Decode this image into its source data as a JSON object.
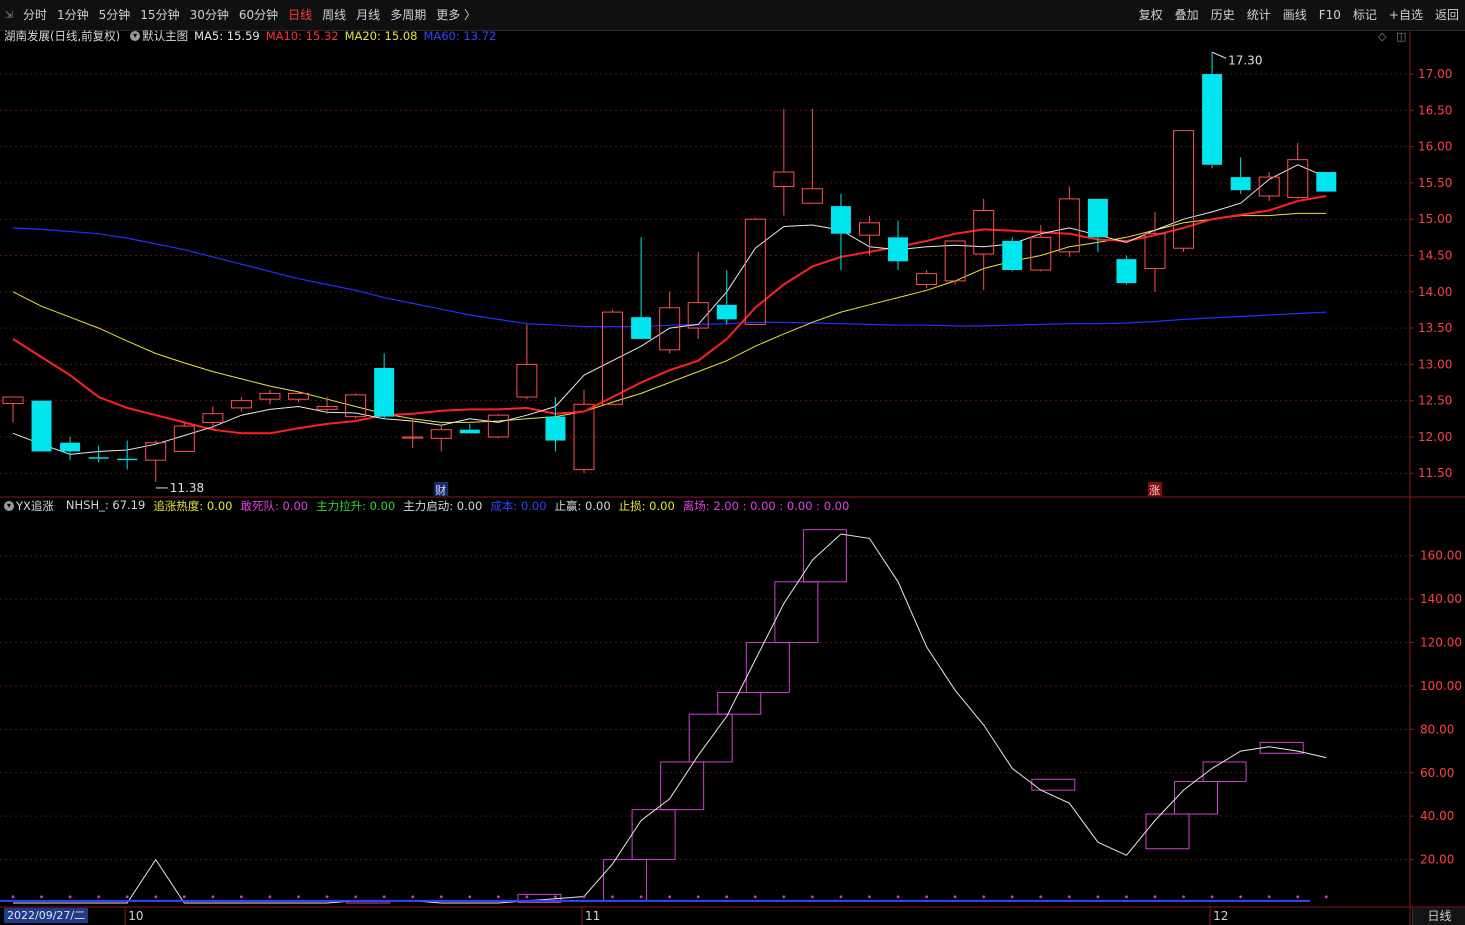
{
  "periods": [
    {
      "label": "分时"
    },
    {
      "label": "1分钟"
    },
    {
      "label": "5分钟"
    },
    {
      "label": "15分钟"
    },
    {
      "label": "30分钟"
    },
    {
      "label": "60分钟"
    },
    {
      "label": "日线",
      "active": true
    },
    {
      "label": "周线"
    },
    {
      "label": "月线"
    },
    {
      "label": "多周期"
    },
    {
      "label": "更多 〉"
    }
  ],
  "tools": [
    "复权",
    "叠加",
    "历史",
    "统计",
    "画线",
    "F10",
    "标记",
    "+自选",
    "返回"
  ],
  "header": {
    "stock_title": "湖南发展(日线,前复权)",
    "main_chart_name": "默认主图",
    "ma5_label": "MA5: 15.59",
    "ma10_label": "MA10: 15.32",
    "ma20_label": "MA20: 15.08",
    "ma60_label": "MA60: 13.72"
  },
  "indicator_header": {
    "name": "YX追涨",
    "items": [
      {
        "text": "NHSH_: 67.19",
        "color": "#d8d8d8"
      },
      {
        "text": "追涨热度: 0.00",
        "color": "#e5e53a"
      },
      {
        "text": "敢死队: 0.00",
        "color": "#e040e0"
      },
      {
        "text": "主力拉升: 0.00",
        "color": "#30d030"
      },
      {
        "text": "主力启动: 0.00",
        "color": "#d8d8d8"
      },
      {
        "text": "成本: 0.00",
        "color": "#3344ff"
      },
      {
        "text": "止赢: 0.00",
        "color": "#d8d8d8"
      },
      {
        "text": "止损: 0.00",
        "color": "#e5e53a"
      },
      {
        "text": "离场: 2.00 : 0.00 : 0.00 : 0.00",
        "color": "#e040e0"
      }
    ]
  },
  "colors": {
    "up": "#ff5050",
    "down": "#00e5ee",
    "ma5": "#e8e8e8",
    "ma10": "#ff2020",
    "ma20": "#e5e53a",
    "ma60": "#2030ff",
    "grid": "#5a1010",
    "nhsh": "#e8e8e8",
    "box": "#d040d0",
    "bottom_line": "#3344ff"
  },
  "annotations": {
    "high_label": "17.30",
    "low_label": "11.38",
    "cai_mark": "财",
    "zhang_mark": "涨"
  },
  "date_label": "2022/09/27/二",
  "x_month_labels": [
    "10",
    "11",
    "12"
  ],
  "right_button": "日线",
  "chart_data": [
    {
      "type": "candlestick",
      "title": "湖南发展(日线,前复权)",
      "ylim": [
        11.2,
        17.4
      ],
      "y_ticks": [
        11.5,
        12.0,
        12.5,
        13.0,
        13.5,
        14.0,
        14.5,
        15.0,
        15.5,
        16.0,
        16.5,
        17.0
      ],
      "candles": [
        {
          "o": 12.46,
          "h": 12.55,
          "l": 12.2,
          "c": 12.55
        },
        {
          "o": 12.5,
          "h": 12.5,
          "l": 11.8,
          "c": 11.8
        },
        {
          "o": 11.92,
          "h": 12.0,
          "l": 11.68,
          "c": 11.8
        },
        {
          "o": 11.72,
          "h": 11.88,
          "l": 11.65,
          "c": 11.7
        },
        {
          "o": 11.7,
          "h": 11.95,
          "l": 11.55,
          "c": 11.68
        },
        {
          "o": 11.68,
          "h": 11.95,
          "l": 11.38,
          "c": 11.92
        },
        {
          "o": 11.8,
          "h": 12.2,
          "l": 11.8,
          "c": 12.15
        },
        {
          "o": 12.2,
          "h": 12.42,
          "l": 12.1,
          "c": 12.32
        },
        {
          "o": 12.4,
          "h": 12.55,
          "l": 12.35,
          "c": 12.5
        },
        {
          "o": 12.52,
          "h": 12.65,
          "l": 12.45,
          "c": 12.6
        },
        {
          "o": 12.52,
          "h": 12.62,
          "l": 12.48,
          "c": 12.6
        },
        {
          "o": 12.38,
          "h": 12.55,
          "l": 12.32,
          "c": 12.42
        },
        {
          "o": 12.28,
          "h": 12.6,
          "l": 12.25,
          "c": 12.58
        },
        {
          "o": 12.95,
          "h": 13.15,
          "l": 12.25,
          "c": 12.28
        },
        {
          "o": 12.0,
          "h": 12.25,
          "l": 11.85,
          "c": 12.0
        },
        {
          "o": 11.98,
          "h": 12.15,
          "l": 11.8,
          "c": 12.1
        },
        {
          "o": 12.1,
          "h": 12.18,
          "l": 12.05,
          "c": 12.05
        },
        {
          "o": 12.0,
          "h": 12.32,
          "l": 11.98,
          "c": 12.3
        },
        {
          "o": 12.55,
          "h": 13.55,
          "l": 12.52,
          "c": 13.0
        },
        {
          "o": 12.28,
          "h": 12.55,
          "l": 11.8,
          "c": 11.95
        },
        {
          "o": 11.55,
          "h": 12.65,
          "l": 11.5,
          "c": 12.45
        },
        {
          "o": 12.45,
          "h": 13.75,
          "l": 12.45,
          "c": 13.72
        },
        {
          "o": 13.65,
          "h": 14.75,
          "l": 13.35,
          "c": 13.35
        },
        {
          "o": 13.2,
          "h": 14.0,
          "l": 13.15,
          "c": 13.78
        },
        {
          "o": 13.5,
          "h": 14.55,
          "l": 13.35,
          "c": 13.85
        },
        {
          "o": 13.82,
          "h": 14.3,
          "l": 13.55,
          "c": 13.62
        },
        {
          "o": 13.55,
          "h": 15.02,
          "l": 13.55,
          "c": 15.0
        },
        {
          "o": 15.45,
          "h": 16.52,
          "l": 15.05,
          "c": 15.65
        },
        {
          "o": 15.22,
          "h": 16.52,
          "l": 15.22,
          "c": 15.42
        },
        {
          "o": 15.18,
          "h": 15.35,
          "l": 14.3,
          "c": 14.8
        },
        {
          "o": 14.78,
          "h": 15.05,
          "l": 14.5,
          "c": 14.95
        },
        {
          "o": 14.75,
          "h": 14.98,
          "l": 14.3,
          "c": 14.42
        },
        {
          "o": 14.1,
          "h": 14.3,
          "l": 14.05,
          "c": 14.25
        },
        {
          "o": 14.15,
          "h": 14.7,
          "l": 14.1,
          "c": 14.7
        },
        {
          "o": 14.52,
          "h": 15.28,
          "l": 14.02,
          "c": 15.12
        },
        {
          "o": 14.7,
          "h": 14.75,
          "l": 14.28,
          "c": 14.3
        },
        {
          "o": 14.3,
          "h": 14.92,
          "l": 14.28,
          "c": 14.75
        },
        {
          "o": 14.55,
          "h": 15.45,
          "l": 14.48,
          "c": 15.28
        },
        {
          "o": 15.28,
          "h": 15.28,
          "l": 14.55,
          "c": 14.75
        },
        {
          "o": 14.45,
          "h": 14.5,
          "l": 14.1,
          "c": 14.12
        },
        {
          "o": 14.32,
          "h": 15.1,
          "l": 14.0,
          "c": 14.8
        },
        {
          "o": 14.6,
          "h": 16.22,
          "l": 14.55,
          "c": 16.22
        },
        {
          "o": 17.0,
          "h": 17.3,
          "l": 15.7,
          "c": 15.75
        },
        {
          "o": 15.58,
          "h": 15.85,
          "l": 15.35,
          "c": 15.4
        },
        {
          "o": 15.32,
          "h": 15.65,
          "l": 15.25,
          "c": 15.58
        },
        {
          "o": 15.3,
          "h": 16.05,
          "l": 15.28,
          "c": 15.82
        },
        {
          "o": 15.65,
          "h": 15.65,
          "l": 15.38,
          "c": 15.38
        }
      ],
      "ma5": [
        12.05,
        11.9,
        11.76,
        11.8,
        11.82,
        11.9,
        12.02,
        12.14,
        12.3,
        12.38,
        12.42,
        12.34,
        12.33,
        12.25,
        12.22,
        12.16,
        12.25,
        12.2,
        12.3,
        12.42,
        12.85,
        13.05,
        13.25,
        13.5,
        13.55,
        14.0,
        14.6,
        14.9,
        14.92,
        14.85,
        14.62,
        14.58,
        14.62,
        14.64,
        14.62,
        14.66,
        14.8,
        14.88,
        14.78,
        14.68,
        14.85,
        15.0,
        15.1,
        15.22,
        15.55,
        15.75,
        15.58
      ],
      "ma10": [
        13.35,
        13.1,
        12.85,
        12.55,
        12.4,
        12.3,
        12.2,
        12.1,
        12.05,
        12.05,
        12.12,
        12.18,
        12.22,
        12.3,
        12.32,
        12.36,
        12.38,
        12.38,
        12.4,
        12.32,
        12.35,
        12.55,
        12.75,
        12.92,
        13.05,
        13.35,
        13.78,
        14.1,
        14.35,
        14.48,
        14.55,
        14.62,
        14.7,
        14.8,
        14.86,
        14.84,
        14.82,
        14.8,
        14.72,
        14.7,
        14.78,
        14.88,
        15.0,
        15.06,
        15.12,
        15.25,
        15.32
      ],
      "ma20": [
        14.0,
        13.8,
        13.65,
        13.5,
        13.32,
        13.15,
        13.02,
        12.9,
        12.8,
        12.7,
        12.62,
        12.52,
        12.42,
        12.32,
        12.25,
        12.2,
        12.2,
        12.22,
        12.25,
        12.28,
        12.35,
        12.48,
        12.6,
        12.75,
        12.9,
        13.05,
        13.25,
        13.42,
        13.58,
        13.72,
        13.82,
        13.92,
        14.02,
        14.15,
        14.32,
        14.42,
        14.5,
        14.62,
        14.68,
        14.75,
        14.85,
        14.95,
        15.0,
        15.05,
        15.05,
        15.08,
        15.08
      ],
      "ma60": [
        14.88,
        14.86,
        14.83,
        14.8,
        14.74,
        14.66,
        14.58,
        14.48,
        14.38,
        14.28,
        14.18,
        14.1,
        14.02,
        13.92,
        13.84,
        13.76,
        13.68,
        13.62,
        13.56,
        13.54,
        13.52,
        13.52,
        13.52,
        13.54,
        13.55,
        13.56,
        13.58,
        13.58,
        13.57,
        13.56,
        13.55,
        13.54,
        13.54,
        13.53,
        13.53,
        13.54,
        13.55,
        13.56,
        13.56,
        13.57,
        13.59,
        13.62,
        13.64,
        13.66,
        13.68,
        13.7,
        13.72
      ]
    },
    {
      "type": "line",
      "title": "YX追涨",
      "ylim": [
        0,
        182
      ],
      "y_ticks": [
        20,
        40,
        60,
        80,
        100,
        120,
        140,
        160
      ],
      "nhsh": [
        0,
        0,
        0,
        0,
        0,
        20,
        0,
        0,
        0,
        0,
        0,
        0,
        1,
        1,
        1,
        0,
        0,
        0,
        1,
        2,
        3,
        18,
        38,
        48,
        68,
        86,
        112,
        138,
        158,
        170,
        168,
        148,
        118,
        98,
        82,
        62,
        52,
        46,
        28,
        22,
        38,
        52,
        62,
        70,
        72,
        70,
        67
      ],
      "boxes": [
        {
          "i": 12,
          "lo": 0.0,
          "hi": 0.8
        },
        {
          "i": 18,
          "lo": 0.3,
          "hi": 4.0
        },
        {
          "i": 21,
          "lo": 1.0,
          "hi": 20.0
        },
        {
          "i": 22,
          "lo": 20.0,
          "hi": 43.0
        },
        {
          "i": 23,
          "lo": 43.0,
          "hi": 65.0
        },
        {
          "i": 24,
          "lo": 65.0,
          "hi": 87.0
        },
        {
          "i": 25,
          "lo": 87.0,
          "hi": 97.0
        },
        {
          "i": 26,
          "lo": 97.0,
          "hi": 120.0
        },
        {
          "i": 27,
          "lo": 120.0,
          "hi": 148.0
        },
        {
          "i": 28,
          "lo": 148.0,
          "hi": 172.0
        },
        {
          "i": 36,
          "lo": 52.0,
          "hi": 57.0
        },
        {
          "i": 40,
          "lo": 25.0,
          "hi": 41.0
        },
        {
          "i": 41,
          "lo": 41.0,
          "hi": 56.0
        },
        {
          "i": 42,
          "lo": 56.0,
          "hi": 65.0
        },
        {
          "i": 44,
          "lo": 69.0,
          "hi": 74.0
        }
      ]
    }
  ]
}
